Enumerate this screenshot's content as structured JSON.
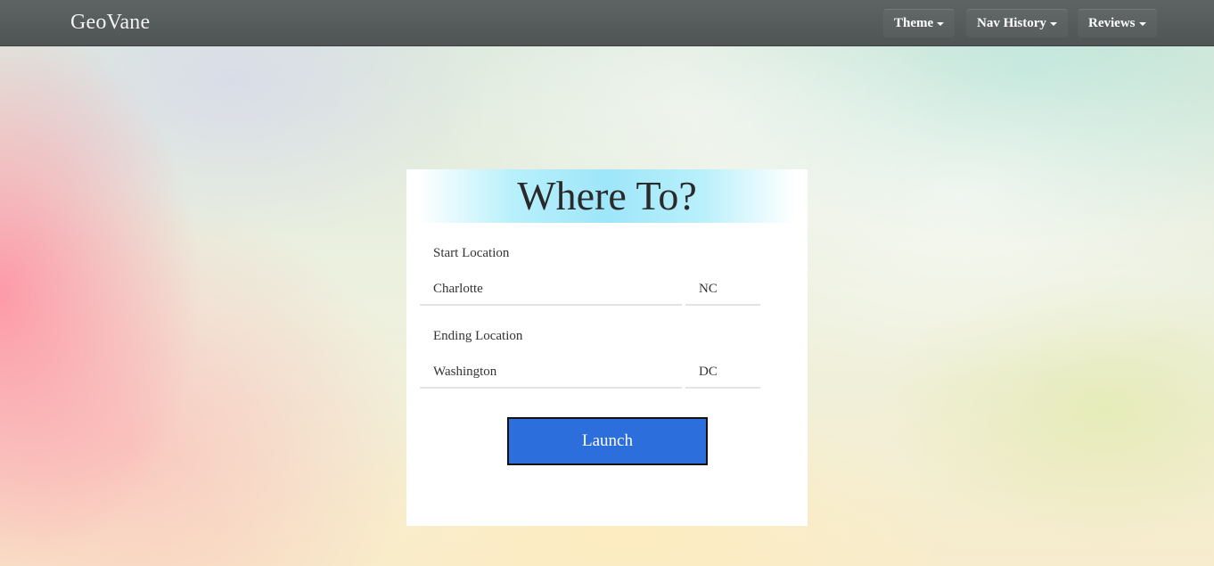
{
  "navbar": {
    "brand": "GeoVane",
    "menus": [
      {
        "label": "Theme"
      },
      {
        "label": "Nav History"
      },
      {
        "label": "Reviews"
      }
    ]
  },
  "form": {
    "title": "Where To?",
    "start": {
      "label": "Start Location",
      "city": "Charlotte",
      "state": "NC"
    },
    "end": {
      "label": "Ending Location",
      "city": "Washington",
      "state": "DC"
    },
    "launch_label": "Launch"
  },
  "colors": {
    "navbar": "#5e6464",
    "header_accent": "#9ee6fa",
    "launch_button": "#2c6fdc"
  }
}
